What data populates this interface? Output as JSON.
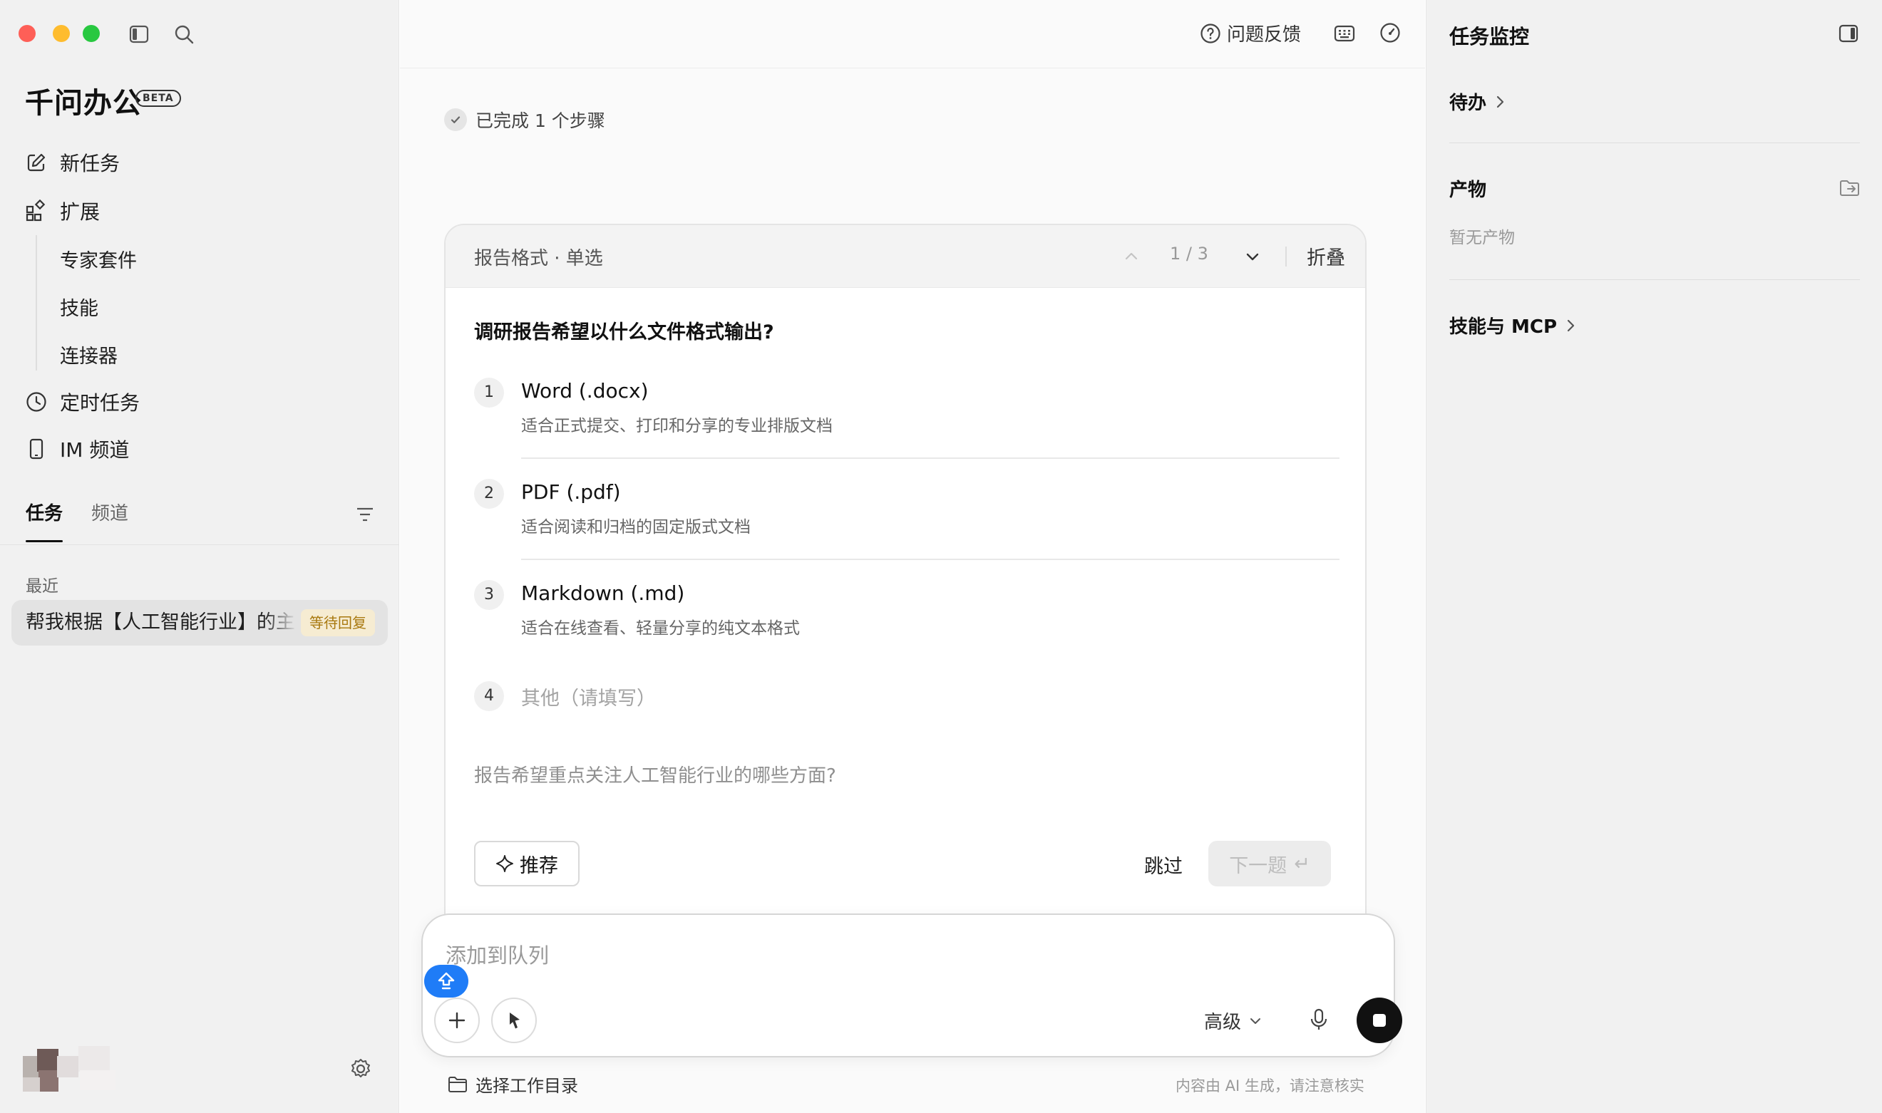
{
  "window": {
    "traffic_lights": [
      "#fe5f57",
      "#febc2e",
      "#28c840"
    ]
  },
  "sidebar": {
    "brand": "千问办公",
    "beta": "BETA",
    "nav": [
      {
        "label": "新任务",
        "icon": "edit-icon"
      },
      {
        "label": "扩展",
        "icon": "extensions-icon"
      }
    ],
    "sub_items": [
      {
        "label": "专家套件"
      },
      {
        "label": "技能"
      },
      {
        "label": "连接器"
      }
    ],
    "nav2": [
      {
        "label": "定时任务",
        "icon": "clock-icon"
      },
      {
        "label": "IM 频道",
        "icon": "phone-icon"
      }
    ],
    "tabs": [
      {
        "label": "任务",
        "active": true
      },
      {
        "label": "频道",
        "active": false
      }
    ],
    "recent_label": "最近",
    "recent_task": {
      "title": "帮我根据【人工智能行业】的主",
      "status": "等待回复"
    }
  },
  "topbar": {
    "feedback": "问题反馈"
  },
  "main": {
    "step_status": "已完成 1 个步骤",
    "question_card": {
      "header": "报告格式 · 单选",
      "pager": "1 / 3",
      "fold": "折叠",
      "question": "调研报告希望以什么文件格式输出?",
      "options": [
        {
          "num": "1",
          "label": "Word (.docx)",
          "desc": "适合正式提交、打印和分享的专业排版文档"
        },
        {
          "num": "2",
          "label": "PDF (.pdf)",
          "desc": "适合阅读和归档的固定版式文档"
        },
        {
          "num": "3",
          "label": "Markdown (.md)",
          "desc": "适合在线查看、轻量分享的纯文本格式"
        }
      ],
      "other": {
        "num": "4",
        "label": "其他（请填写）"
      },
      "next_question": "报告希望重点关注人工智能行业的哪些方面?",
      "recommend": "推荐",
      "skip": "跳过",
      "next": "下一题",
      "next_key": "↵"
    },
    "composer": {
      "placeholder": "添加到队列",
      "model": "高级"
    },
    "workdir": "选择工作目录",
    "disclaimer": "内容由 AI 生成，请注意核实"
  },
  "right_panel": {
    "title": "任务监控",
    "todo": "待办",
    "artifacts": "产物",
    "artifacts_empty": "暂无产物",
    "skills": "技能与 MCP"
  }
}
